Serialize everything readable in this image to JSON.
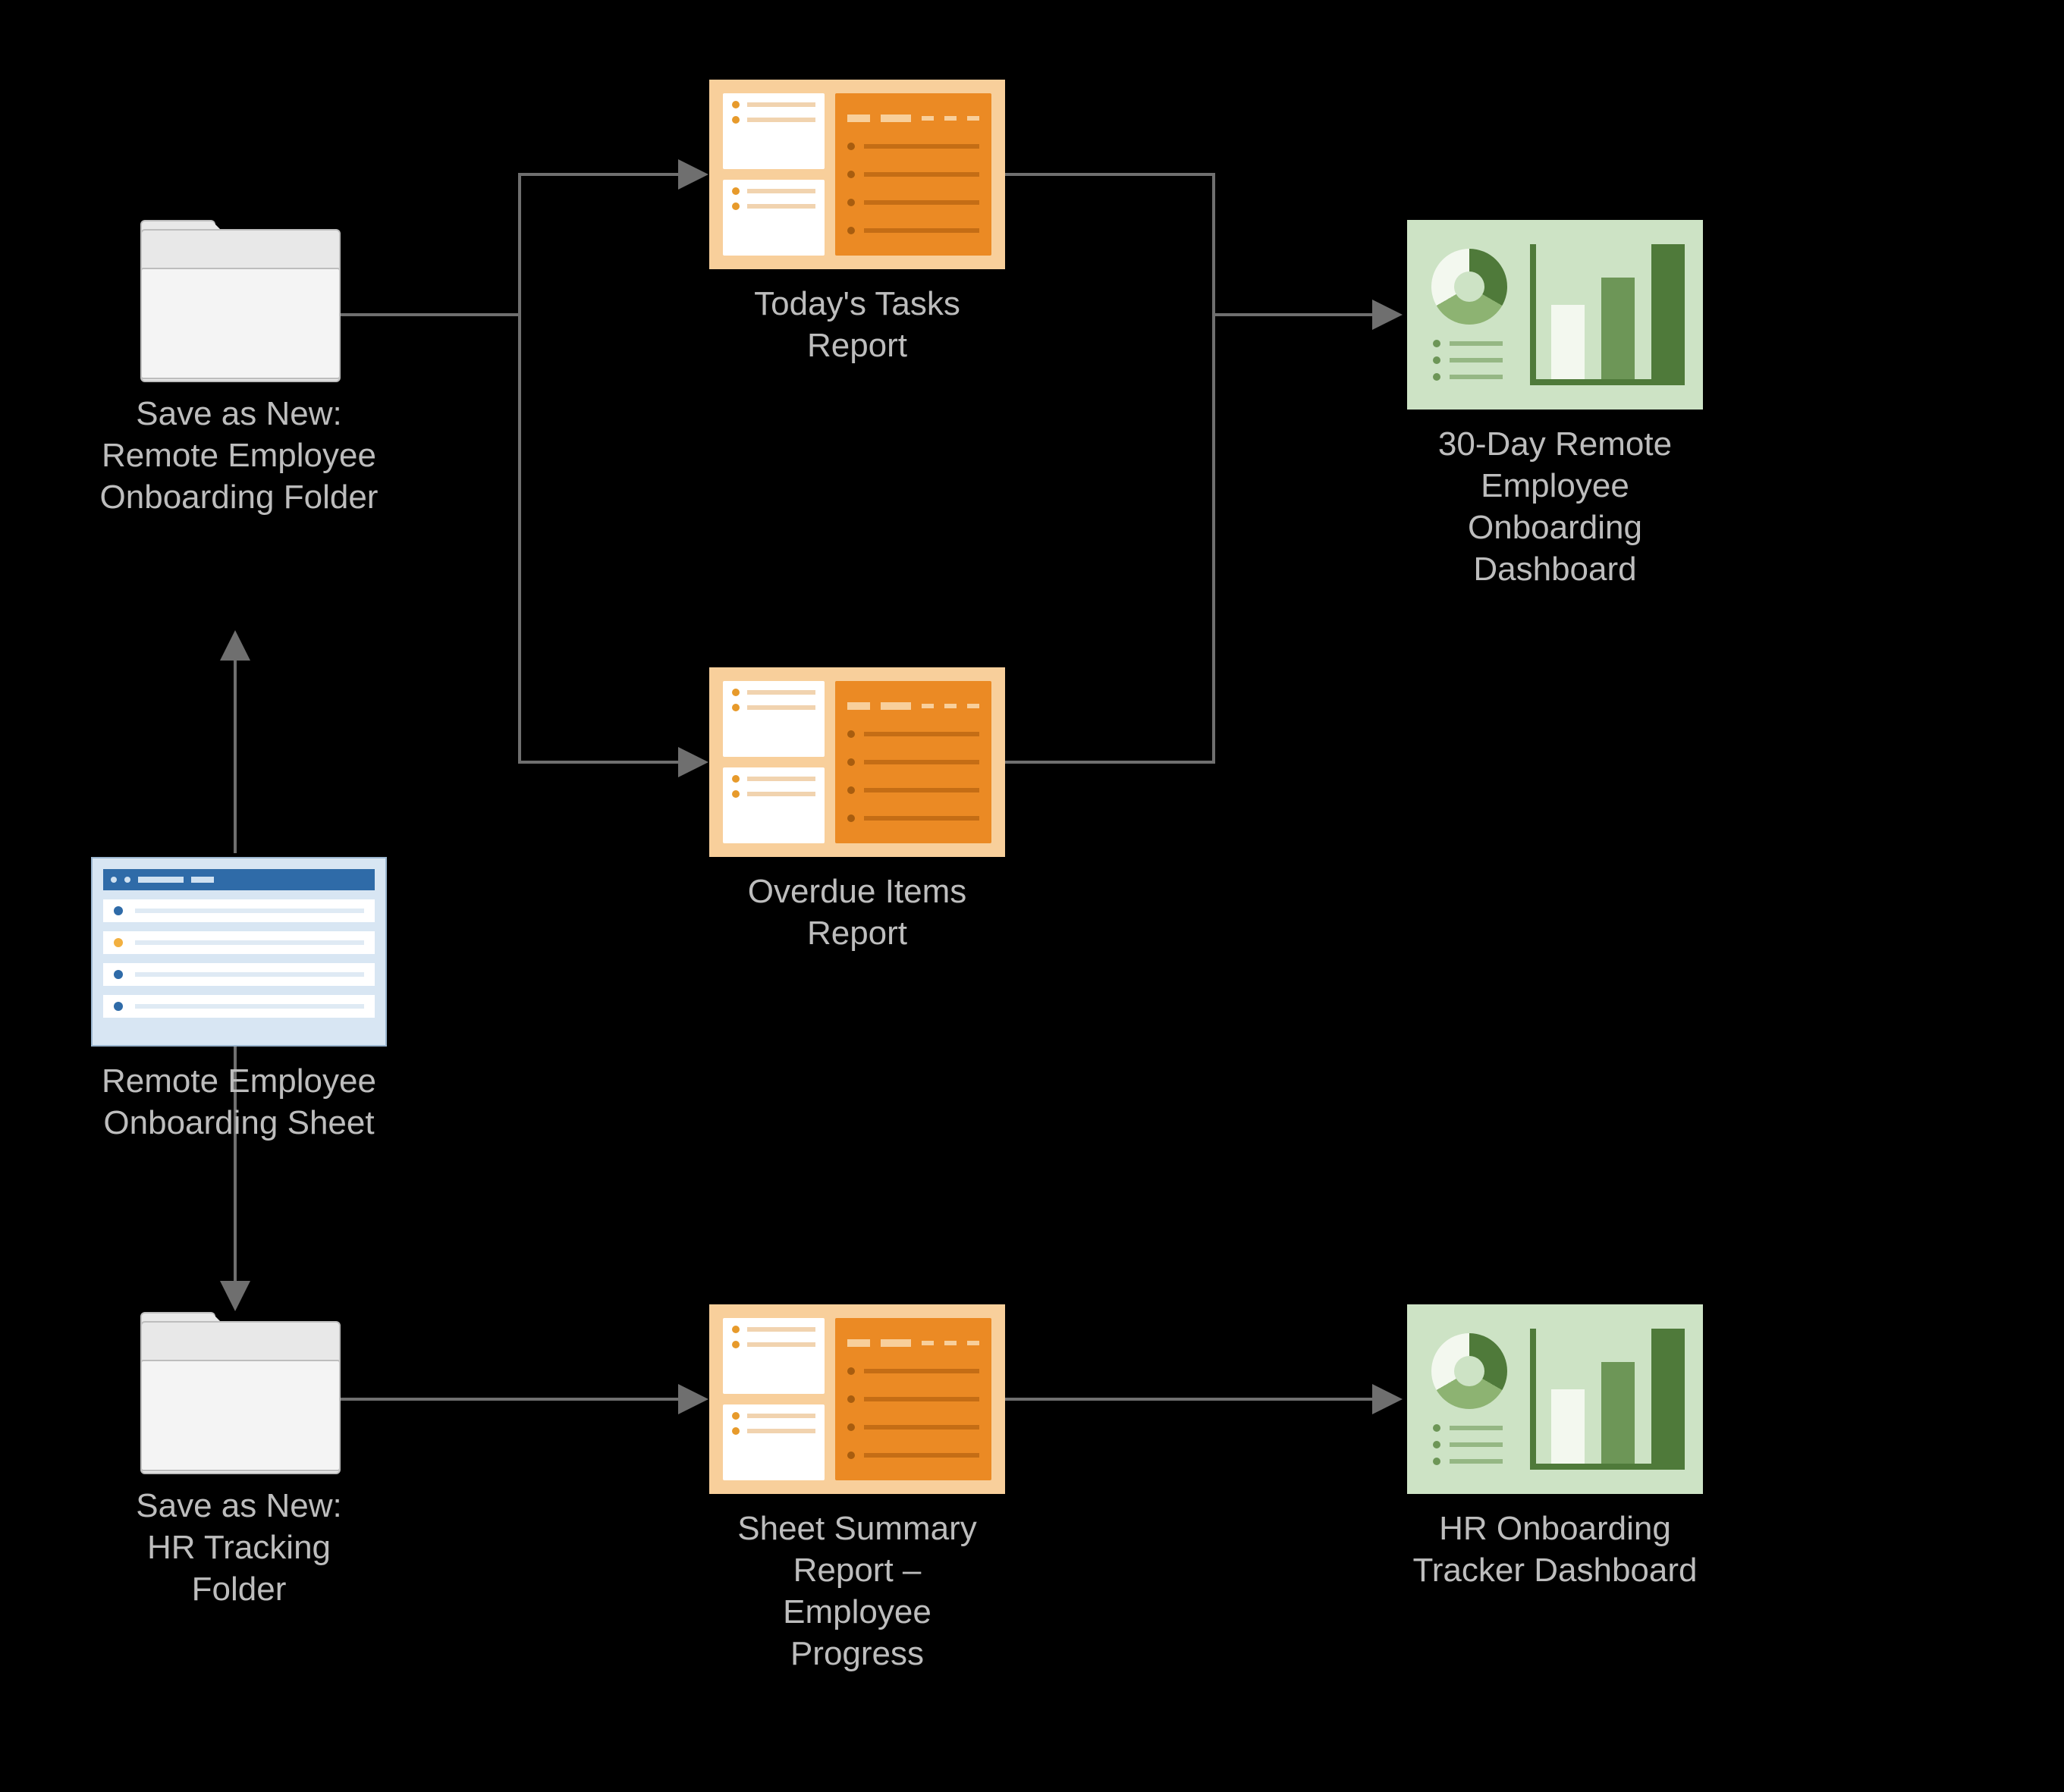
{
  "nodes": {
    "folder_top": {
      "label": "Save as New:\nRemote Employee\nOnboarding Folder"
    },
    "sheet": {
      "label": "Remote Employee\nOnboarding Sheet"
    },
    "folder_bottom": {
      "label": "Save as New:\nHR Tracking\nFolder"
    },
    "report_top": {
      "label": "Today's Tasks\nReport"
    },
    "report_mid": {
      "label": "Overdue Items\nReport"
    },
    "report_bottom": {
      "label": "Sheet Summary\nReport –\nEmployee\nProgress"
    },
    "dash_top": {
      "label": "30-Day Remote\nEmployee\nOnboarding\nDashboard"
    },
    "dash_bottom": {
      "label": "HR Onboarding\nTracker Dashboard"
    }
  },
  "colors": {
    "folder_fill": "#e8e8e8",
    "folder_front": "#f4f4f4",
    "sheet_bg": "#d8e6f3",
    "sheet_header": "#2f6ba8",
    "report_bg": "#f8cf9b",
    "report_accent": "#eb8a24",
    "dashboard_bg": "#cde3c5",
    "dashboard_dark": "#4f7a3a",
    "arrow": "#6f6f6f",
    "text": "#bdbdbd",
    "canvas": "#000000"
  }
}
